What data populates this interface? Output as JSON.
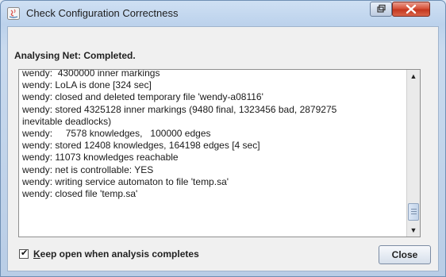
{
  "window": {
    "title": "Check Configuration Correctness",
    "app_icon": "java-icon",
    "controls": {
      "restore_icon": "restore-icon",
      "close_icon": "close-icon"
    }
  },
  "status": {
    "label": "Analysing Net: Completed."
  },
  "log": {
    "lines": [
      "wendy:  4300000 inner markings",
      "wendy: LoLA is done [324 sec]",
      "wendy: closed and deleted temporary file 'wendy-a08116'",
      "wendy: stored 4325128 inner markings (9480 final, 1323456 bad, 2879275",
      "inevitable deadlocks)",
      "wendy:     7578 knowledges,   100000 edges",
      "wendy: stored 12408 knowledges, 164198 edges [4 sec]",
      "wendy: 11073 knowledges reachable",
      "wendy: net is controllable: YES",
      "wendy: writing service automaton to file 'temp.sa'",
      "wendy: closed file 'temp.sa'"
    ],
    "scroll": {
      "up_icon": "scroll-up-icon",
      "down_icon": "scroll-down-icon"
    }
  },
  "footer": {
    "keep_open_label_accesskey": "K",
    "keep_open_label_rest": "eep open when analysis completes",
    "keep_open_checked": true,
    "close_label": "Close"
  },
  "colors": {
    "title_bar": "#bcd2ec",
    "close_button": "#c4371f",
    "log_bg": "#ffffff"
  }
}
